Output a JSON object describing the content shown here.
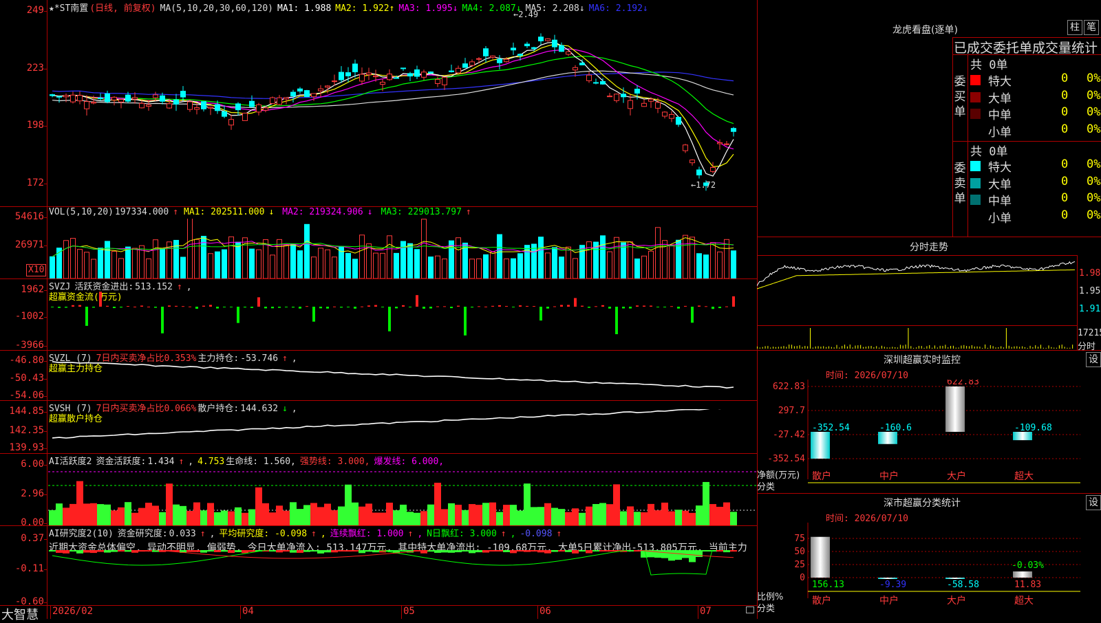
{
  "main": {
    "title": "★*ST南置",
    "period": "(日线, 前复权)",
    "ma_params": "MA(5,10,20,30,60,120)",
    "ma": [
      {
        "label": "MA1:",
        "value": "1.988",
        "arrow": "",
        "color": "#ffffff"
      },
      {
        "label": "MA2:",
        "value": "1.922",
        "arrow": "↑",
        "color": "#ffff00"
      },
      {
        "label": "MA3:",
        "value": "1.995",
        "arrow": "↓",
        "color": "#ff00ff"
      },
      {
        "label": "MA4:",
        "value": "2.087",
        "arrow": "↓",
        "color": "#00ff00"
      },
      {
        "label": "MA5:",
        "value": "2.208",
        "arrow": "↓",
        "color": "#dddddd"
      },
      {
        "label": "MA6:",
        "value": "2.192",
        "arrow": "↓",
        "color": "#3333ff"
      }
    ],
    "y_labels": [
      "249",
      "223",
      "198",
      "172"
    ],
    "high_label": "2.49",
    "low_label": "1.72"
  },
  "vol": {
    "params": "VOL(5,10,20)",
    "value": "197334.000",
    "arrow": "↑",
    "ma1": "MA1: 202511.000",
    "ma1_arrow": "↓",
    "ma2": "MA2: 219324.906",
    "ma2_arrow": "↓",
    "ma3": "MA3: 229013.797",
    "ma3_arrow": "↑",
    "y_labels": [
      "54616",
      "26971"
    ],
    "unit": "X10"
  },
  "svzj": {
    "name": "SVZJ",
    "label": "活跃资金进出:",
    "value": "513.152",
    "arrow": "↑",
    "sub": "超赢资金流(万元)",
    "y_labels": [
      "1962",
      "-1002",
      "-3966"
    ]
  },
  "svzl": {
    "name": "SVZL (7)",
    "ratio": "7日内买卖净占比0.353%",
    "label": "主力持仓:",
    "value": "-53.746",
    "arrow": "↑",
    "sub": "超赢主力持仓",
    "y_labels": [
      "-46.80",
      "-50.43",
      "-54.06"
    ]
  },
  "svsh": {
    "name": "SVSH (7)",
    "ratio": "7日内买卖净占比0.066%",
    "label": "散户持仓:",
    "value": "144.632",
    "arrow": "↓",
    "sub": "超赢散户持仓",
    "y_labels": [
      "144.85",
      "142.35",
      "139.93"
    ]
  },
  "ai_active": {
    "name": "AI活跃度2",
    "label": "资金活跃度:",
    "value": "1.434",
    "arrow": "↑",
    "v2": "4.753",
    "life": "生命线: 1.560,",
    "strong": "强势线: 3.000,",
    "burst": "爆发线: 6.000,",
    "y_labels": [
      "6.00",
      "2.96",
      "0.00"
    ]
  },
  "ai_research": {
    "name": "AI研究度2(10)",
    "label": "资金研究度:",
    "value": "0.033",
    "arrow": "↑",
    "avg": "平均研究度: -0.098",
    "avg_arrow": "↑",
    "red": "连续飘红: 1.000",
    "red_arrow": "↑",
    "nred": "N日飘红: 3.000",
    "nred_arrow": "↑",
    "last": "-0.098",
    "last_arrow": "↑",
    "summary": "近期大资金总体偏空, 异动不明显, 偏弱势, 今日大单净流入: 513.147万元, 其中特大单净流出: -109.68万元, 大单5日累计净出-513.805万元, 当前主力",
    "y_labels": [
      "0.37",
      "-0.11",
      "-0.60"
    ]
  },
  "xaxis": {
    "brand": "大智慧",
    "dates": [
      "2026/02",
      "04",
      "05",
      "06",
      "07"
    ]
  },
  "lhb": {
    "title": "龙虎看盘(逐单)",
    "btn1": "柱",
    "btn2": "笔",
    "header": "已成交委托单成交量统计",
    "buy": {
      "side_label": "委买单",
      "total": "共 0单",
      "rows": [
        {
          "name": "特大",
          "v1": "0",
          "v2": "0%",
          "color": "#ff0000"
        },
        {
          "name": "大单",
          "v1": "0",
          "v2": "0%",
          "color": "#8b0000"
        },
        {
          "name": "中单",
          "v1": "0",
          "v2": "0%",
          "color": "#5a0000"
        },
        {
          "name": "小单",
          "v1": "0",
          "v2": "0%",
          "color": ""
        }
      ]
    },
    "sell": {
      "side_label": "委卖单",
      "total": "共 0单",
      "rows": [
        {
          "name": "特大",
          "v1": "0",
          "v2": "0%",
          "color": "#00ffff"
        },
        {
          "name": "大单",
          "v1": "0",
          "v2": "0%",
          "color": "#00a0a0"
        },
        {
          "name": "中单",
          "v1": "0",
          "v2": "0%",
          "color": "#007070"
        },
        {
          "name": "小单",
          "v1": "0",
          "v2": "0%",
          "color": ""
        }
      ]
    }
  },
  "intraday": {
    "title": "分时走势",
    "y_labels": [
      "1.985",
      "1.950",
      "1.915"
    ],
    "vol_label": "17215",
    "time_label": "分时"
  },
  "sz_monitor": {
    "title": "深圳超赢实时监控",
    "btn": "设",
    "time": "时间: 2026/07/10",
    "ylabel1": "净额(万元)",
    "ylabel2": "分类",
    "y_labels": [
      "622.83",
      "297.7",
      "-27.42",
      "-352.54"
    ],
    "categories": [
      "散户",
      "中户",
      "大户",
      "超大"
    ],
    "values": [
      -352.54,
      -160.6,
      622.83,
      -109.68
    ],
    "value_labels": [
      "-352.54",
      "-160.6",
      "622.83",
      "-109.68"
    ]
  },
  "sz_class": {
    "title": "深市超赢分类统计",
    "btn": "设",
    "time": "时间: 2026/07/10",
    "ylabel1": "比例%",
    "ylabel2": "分类",
    "y_labels": [
      "75",
      "50",
      "25",
      "0"
    ],
    "categories": [
      "散户",
      "中户",
      "大户",
      "超大"
    ],
    "values": [
      156.13,
      -9.39,
      -58.58,
      11.83
    ],
    "value_labels": [
      "156.13",
      "-9.39",
      "-58.58",
      "11.83"
    ],
    "extra_label": "-0.03%"
  },
  "chart_data": [
    {
      "type": "bar",
      "categories": [
        "散户",
        "中户",
        "大户",
        "超大"
      ],
      "values": [
        -352.54,
        -160.6,
        622.83,
        -109.68
      ],
      "ylabel": "净额(万元)",
      "xlabel": "分类",
      "ylim": [
        -352.54,
        622.83
      ]
    },
    {
      "type": "bar",
      "categories": [
        "散户",
        "中户",
        "大户",
        "超大"
      ],
      "values": [
        156.13,
        -9.39,
        -58.58,
        11.83
      ],
      "ylabel": "比例%",
      "xlabel": "分类",
      "ylim": [
        0,
        75
      ]
    }
  ]
}
